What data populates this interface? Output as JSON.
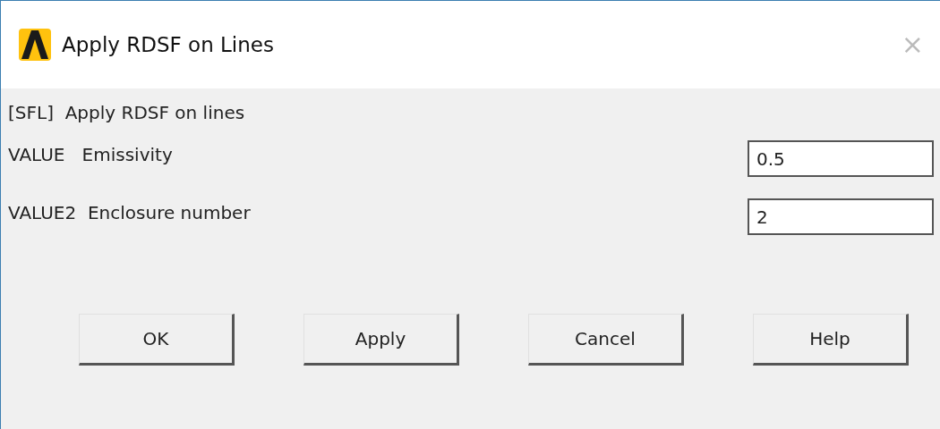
{
  "window": {
    "title": "Apply RDSF on Lines",
    "close": "×"
  },
  "command": "[SFL]  Apply RDSF on lines",
  "fields": [
    {
      "label": "VALUE   Emissivity",
      "value": "0.5"
    },
    {
      "label": "VALUE2  Enclosure number",
      "value": "2"
    }
  ],
  "buttons": [
    "OK",
    "Apply",
    "Cancel",
    "Help"
  ]
}
